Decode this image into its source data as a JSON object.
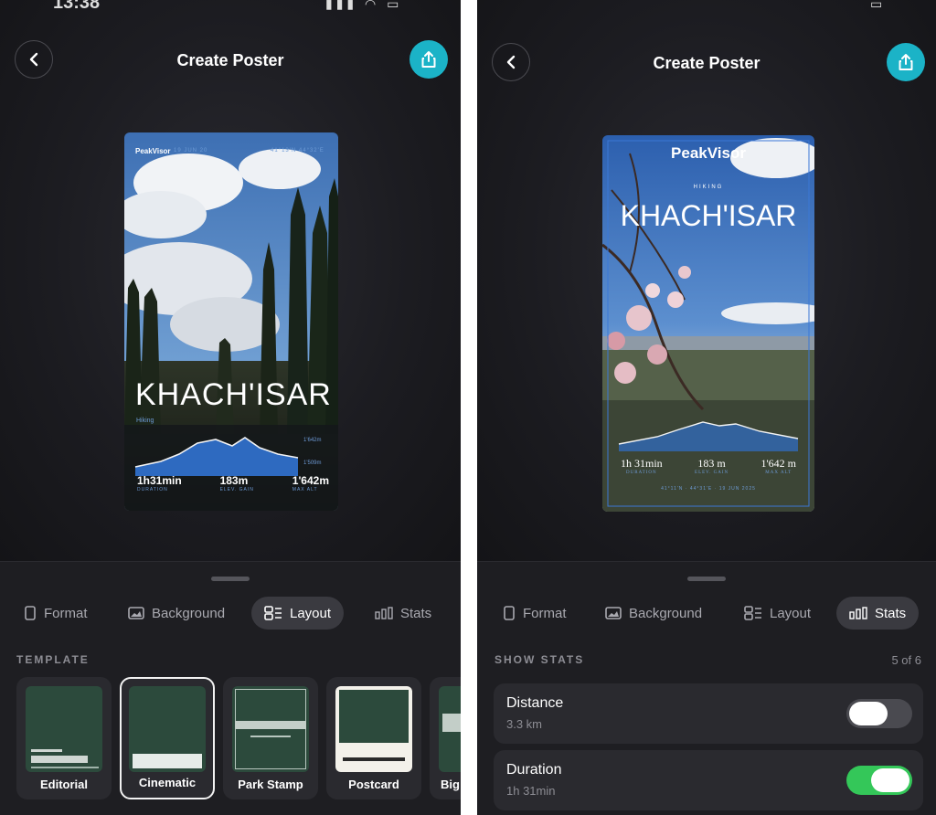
{
  "app": {
    "title": "Create Poster",
    "status_time": "13:38",
    "icons": [
      "back-icon",
      "share-icon",
      "status-signal-icon",
      "wifi-icon",
      "battery-icon"
    ]
  },
  "tabs": [
    {
      "label": "Format",
      "icon": "format-icon"
    },
    {
      "label": "Background",
      "icon": "image-icon"
    },
    {
      "label": "Layout",
      "icon": "layout-icon"
    },
    {
      "label": "Stats",
      "icon": "stats-icon"
    }
  ],
  "left": {
    "active_tab": "Layout",
    "section_label": "TEMPLATE",
    "templates": [
      {
        "label": "Editorial"
      },
      {
        "label": "Cinematic",
        "selected": true
      },
      {
        "label": "Park Stamp"
      },
      {
        "label": "Postcard"
      },
      {
        "label": "Big"
      }
    ],
    "poster": {
      "brand": "PeakVisor",
      "date": "19 JUN 20",
      "coords": "41°13'N  44°32'E",
      "place": "KHACH'ISAR",
      "activity": "Hiking",
      "alt_top": "1'642m",
      "alt_bottom": "1'509m",
      "stats": [
        {
          "value": "1h31min",
          "label": "DURATION"
        },
        {
          "value": "183m",
          "label": "ELEV. GAIN"
        },
        {
          "value": "1'642m",
          "label": "MAX ALT"
        }
      ]
    }
  },
  "right": {
    "active_tab": "Stats",
    "section_label": "SHOW STATS",
    "count": "5 of 6",
    "stats_options": [
      {
        "name": "Distance",
        "value": "3.3 km",
        "enabled": false
      },
      {
        "name": "Duration",
        "value": "1h 31min",
        "enabled": true
      }
    ],
    "poster": {
      "brand": "PeakVisor",
      "activity": "HIKING",
      "place": "KHACH'ISAR",
      "footer": "41°11'N · 44°31'E · 19 JUN 2025",
      "stats": [
        {
          "value": "1h 31min",
          "label": "DURATION"
        },
        {
          "value": "183 m",
          "label": "ELEV. GAIN"
        },
        {
          "value": "1'642 m",
          "label": "MAX ALT"
        }
      ]
    }
  },
  "colors": {
    "accent": "#1bb3c7",
    "toggle_on": "#34c759",
    "poster_blue": "#2f6fc9"
  }
}
